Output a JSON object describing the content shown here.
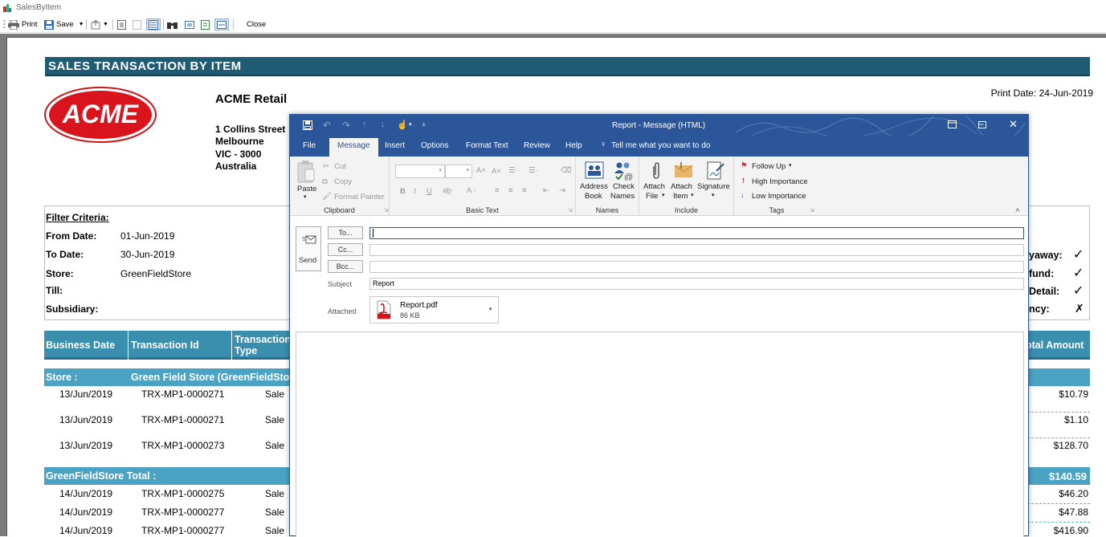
{
  "window": {
    "title": "SalesByItem"
  },
  "toolbar": {
    "print": "Print",
    "save": "Save",
    "close": "Close"
  },
  "report": {
    "title": "SALES TRANSACTION BY ITEM",
    "logo_text": "ACME",
    "company": "ACME Retail",
    "address": [
      "1 Collins Street",
      "Melbourne",
      "VIC - 3000",
      "Australia"
    ],
    "print_date": "Print Date: 24-Jun-2019",
    "filter": {
      "title": "Filter Criteria:",
      "from_date_label": "From Date:",
      "from_date": "01-Jun-2019",
      "to_date_label": "To Date:",
      "to_date": "30-Jun-2019",
      "store_label": "Store:",
      "store": "GreenFieldStore",
      "till_label": "Till:",
      "subsidiary_label": "Subsidiary:",
      "right_labels": [
        "yaway:",
        "fund:",
        "Detail:",
        "ncy:"
      ],
      "right_marks": [
        "✓",
        "✓",
        "✓",
        "✗"
      ]
    },
    "columns": {
      "business_date": "Business Date",
      "transaction_id": "Transaction Id",
      "transaction_type": "Transaction Type",
      "total_amount": "otal Amount"
    },
    "store_group": {
      "label": "Store :",
      "name": "Green Field Store (GreenFieldSto"
    },
    "rows_a": [
      {
        "date": "13/Jun/2019",
        "id": "TRX-MP1-0000271",
        "type": "Sale",
        "amount": "$10.79"
      },
      {
        "date": "13/Jun/2019",
        "id": "TRX-MP1-0000271",
        "type": "Sale",
        "amount": "$1.10"
      },
      {
        "date": "13/Jun/2019",
        "id": "TRX-MP1-0000273",
        "type": "Sale",
        "amount": "$128.70"
      }
    ],
    "store_total": {
      "label": "GreenFieldStore Total :",
      "amount": "$140.59"
    },
    "rows_b": [
      {
        "date": "14/Jun/2019",
        "id": "TRX-MP1-0000275",
        "type": "Sale",
        "amount": "$46.20"
      },
      {
        "date": "14/Jun/2019",
        "id": "TRX-MP1-0000277",
        "type": "Sale",
        "amount": "$47.88"
      },
      {
        "date": "14/Jun/2019",
        "id": "TRX-MP1-0000277",
        "type": "Sale",
        "amount": "$416.90"
      }
    ]
  },
  "outlook": {
    "title": "Report  -  Message (HTML)",
    "tabs": [
      "File",
      "Message",
      "Insert",
      "Options",
      "Format Text",
      "Review",
      "Help"
    ],
    "tell_me": "Tell me what you want to do",
    "clipboard": {
      "paste": "Paste",
      "cut": "Cut",
      "copy": "Copy",
      "format_painter": "Format Painter",
      "group": "Clipboard"
    },
    "basic_text": {
      "group": "Basic Text"
    },
    "names": {
      "address_book": [
        "Address",
        "Book"
      ],
      "check_names": [
        "Check",
        "Names"
      ],
      "group": "Names"
    },
    "include": {
      "attach_file": [
        "Attach",
        "File"
      ],
      "attach_item": [
        "Attach",
        "Item"
      ],
      "signature": "Signature",
      "group": "Include"
    },
    "tags": {
      "follow_up": "Follow Up",
      "high": "High Importance",
      "low": "Low Importance",
      "group": "Tags"
    },
    "send": "Send",
    "to_btn": "To...",
    "cc_btn": "Cc...",
    "bcc_btn": "Bcc...",
    "subject_label": "Subject",
    "subject": "Report",
    "attached_label": "Attached",
    "attachment": {
      "name": "Report.pdf",
      "size": "86 KB"
    }
  }
}
